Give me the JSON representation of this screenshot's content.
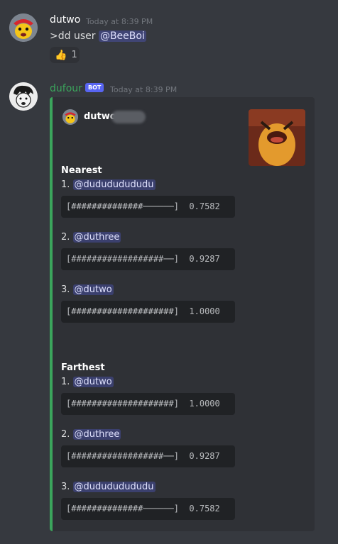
{
  "messages": [
    {
      "author": "dutwo",
      "author_color": "#ffffff",
      "timestamp": "Today at 8:39 PM",
      "content_prefix": ">dd user ",
      "content_mention": "@BeeBoi",
      "reaction": {
        "emoji": "👍",
        "count": "1"
      }
    },
    {
      "author": "dufour",
      "author_color": "#3ba55c",
      "bot_badge": "BOT",
      "timestamp": "Today at 8:39 PM",
      "embed": {
        "author": "dutwo",
        "border_color": "#3ba55c",
        "nearest_title": "Nearest",
        "nearest": [
          {
            "rank": "1.",
            "user": "@dudududududu",
            "bar": "[##############──────]  0.7582"
          },
          {
            "rank": "2.",
            "user": "@duthree",
            "bar": "[##################──]  0.9287"
          },
          {
            "rank": "3.",
            "user": "@dutwo",
            "bar": "[####################]  1.0000"
          }
        ],
        "farthest_title": "Farthest",
        "farthest": [
          {
            "rank": "1.",
            "user": "@dutwo",
            "bar": "[####################]  1.0000"
          },
          {
            "rank": "2.",
            "user": "@duthree",
            "bar": "[##################──]  0.9287"
          },
          {
            "rank": "3.",
            "user": "@dudududududu",
            "bar": "[##############──────]  0.7582"
          }
        ]
      }
    }
  ]
}
